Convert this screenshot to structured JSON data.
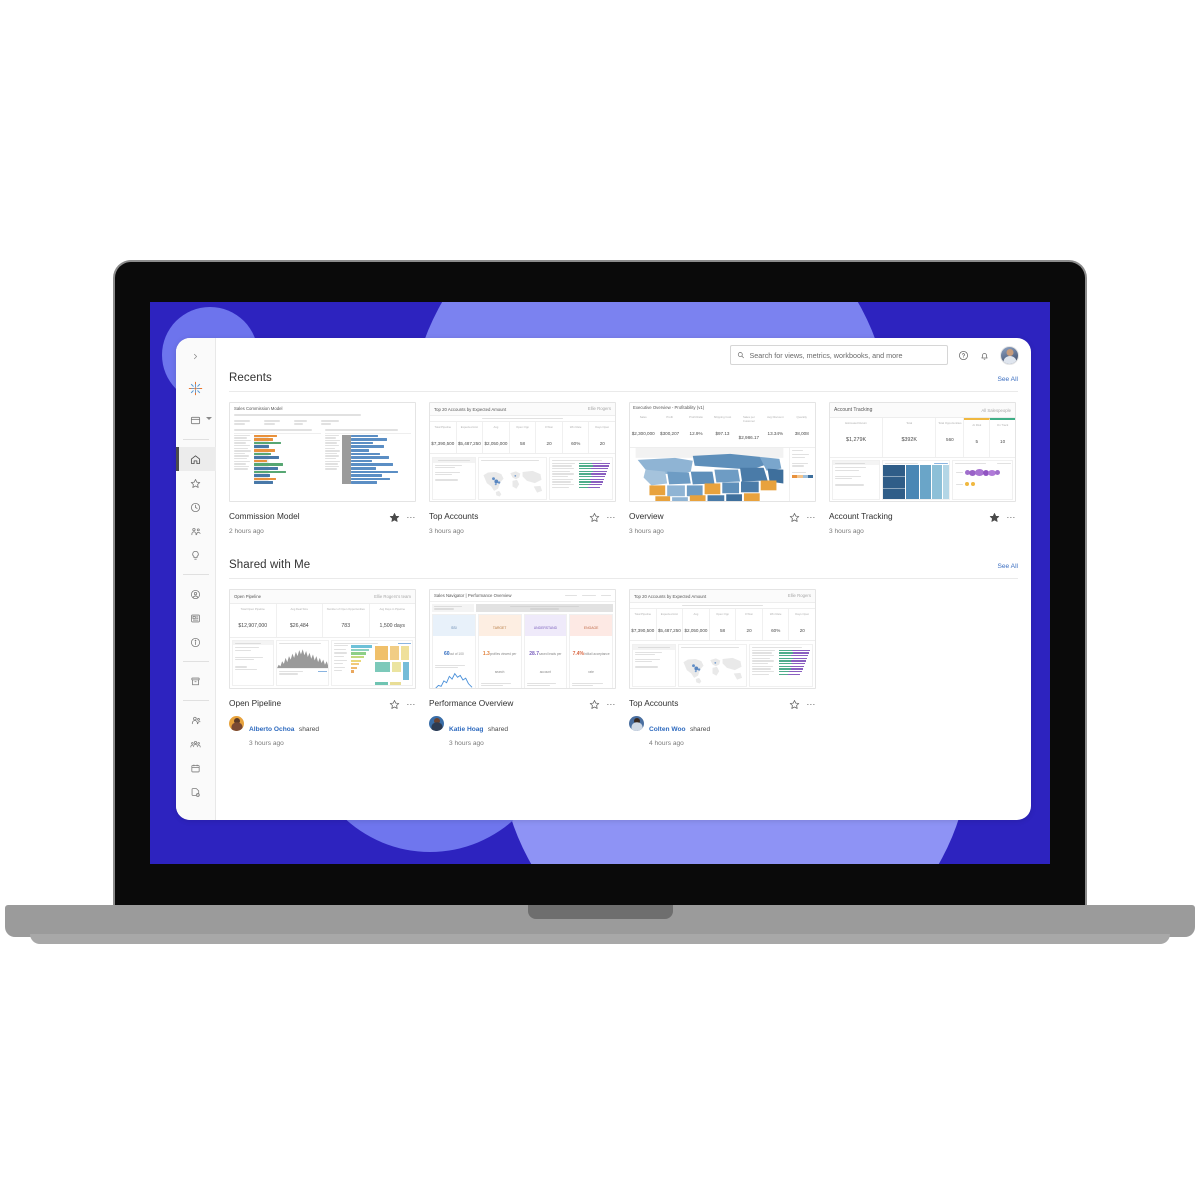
{
  "app": {
    "name": "tableau-home",
    "search": {
      "placeholder": "Search for views, metrics, workbooks, and more",
      "value": ""
    },
    "topbar_icons": [
      "help-icon",
      "notifications-icon",
      "user-avatar"
    ]
  },
  "sidebar": {
    "collapse_label": "›",
    "items": [
      {
        "name": "sidebar-item-explore",
        "icon": "browser-window-icon",
        "active": false,
        "caret": true
      },
      {
        "name": "sidebar-item-home",
        "icon": "home-icon",
        "active": true
      },
      {
        "name": "sidebar-item-favorites",
        "icon": "star-icon",
        "active": false
      },
      {
        "name": "sidebar-item-recents",
        "icon": "clock-history-icon",
        "active": false
      },
      {
        "name": "sidebar-item-shared-with-me",
        "icon": "people-shared-icon",
        "active": false
      },
      {
        "name": "sidebar-item-recommendations",
        "icon": "lightbulb-icon",
        "active": false
      },
      {
        "name": "sidebar-item-personal-space",
        "icon": "person-circle-icon",
        "active": false
      },
      {
        "name": "sidebar-item-collections",
        "icon": "collections-icon",
        "active": false
      },
      {
        "name": "sidebar-item-external-assets",
        "icon": "info-circle-icon",
        "active": false
      },
      {
        "name": "sidebar-item-archive",
        "icon": "archive-box-icon",
        "active": false
      },
      {
        "name": "sidebar-item-users",
        "icon": "users-icon",
        "active": false
      },
      {
        "name": "sidebar-item-groups",
        "icon": "group-icon",
        "active": false
      },
      {
        "name": "sidebar-item-schedules",
        "icon": "calendar-icon",
        "active": false
      },
      {
        "name": "sidebar-item-tasks",
        "icon": "task-page-icon",
        "active": false
      }
    ]
  },
  "sections": [
    {
      "id": "recents",
      "title": "Recents",
      "see_all": "See All",
      "cards": [
        {
          "title": "Commission Model",
          "subtitle": "2 hours ago",
          "favorited": true,
          "menu": "⋯",
          "thumb": {
            "kind": "commission",
            "header": "Sales Commission Model",
            "panel_titles": [
              "Simulated Quota Attainment Results with These Assumptions",
              "Total Compensation with These Assumptions"
            ]
          }
        },
        {
          "title": "Top Accounts",
          "subtitle": "3 hours ago",
          "favorited": false,
          "menu": "⋯",
          "thumb": {
            "kind": "topaccounts",
            "header": "Top 20 Accounts by Expected Amount",
            "owner": "Ellie Rogers",
            "kpis": [
              {
                "label": "Total Pipeline",
                "value": "$7,390,500"
              },
              {
                "label": "Expected Amt",
                "value": "$5,487,250"
              },
              {
                "label": "Avg",
                "value": "$2,050,000"
              },
              {
                "label": "Open Opp",
                "value": "58"
              },
              {
                "label": "# Won",
                "value": "20"
              },
              {
                "label": "Win Rate",
                "value": "60%"
              },
              {
                "label": "Days Open",
                "value": "20"
              }
            ]
          }
        },
        {
          "title": "Overview",
          "subtitle": "3 hours ago",
          "favorited": false,
          "menu": "⋯",
          "thumb": {
            "kind": "overview",
            "header": "Executive Overview - Profitability (v1)",
            "kpi_labels": [
              "Sales",
              "Profit",
              "Profit Ratio",
              "Shipping Cost",
              "Sales per Customer",
              "Avg Discount",
              "Quantity"
            ],
            "kpi_values": [
              "$2,300,000",
              "$300,207",
              "12.9%",
              "$97.13",
              "$2,986.17",
              "13.34%",
              "38,008"
            ]
          }
        },
        {
          "title": "Account Tracking",
          "subtitle": "3 hours ago",
          "favorited": true,
          "menu": "⋯",
          "thumb": {
            "kind": "tracking",
            "header": "Account Tracking",
            "filter": "All Salespeople",
            "kpi_labels": [
              "Estimated Return",
              "Total",
              "Total Opportunities",
              "At Risk",
              "On Track"
            ],
            "kpi_values": [
              "$1,279K",
              "$392K",
              "560",
              "5",
              "10"
            ]
          }
        }
      ]
    },
    {
      "id": "shared-with-me",
      "title": "Shared with Me",
      "see_all": "See All",
      "cards": [
        {
          "title": "Open Pipeline",
          "shared_by": "Alberto Ochoa",
          "shared_verb": "shared",
          "subtitle": "3 hours ago",
          "favorited": false,
          "menu": "⋯",
          "avatar_color": "#e8a33d",
          "thumb": {
            "kind": "pipeline",
            "header": "Open Pipeline",
            "owner": "Ellie Rogers's team",
            "kpi_labels": [
              "Total Open Pipeline",
              "Avg Deal Size",
              "Number of Open Opportunities",
              "Avg Days in Pipeline"
            ],
            "kpi_values": [
              "$12,907,000",
              "$26,484",
              "783",
              "1,500 days"
            ]
          }
        },
        {
          "title": "Performance Overview",
          "shared_by": "Katie Hoag",
          "shared_verb": "shared",
          "subtitle": "3 hours ago",
          "favorited": false,
          "menu": "⋯",
          "avatar_color": "#3a6ea8",
          "thumb": {
            "kind": "performance",
            "header": "Sales Navigator | Performance Overview",
            "cols": [
              {
                "head": "SSI",
                "value": "60",
                "unit": "out of 100",
                "color": "#e8f1fa",
                "accent": "#2f6bbf"
              },
              {
                "head": "TARGET",
                "value": "1.3",
                "unit": "profiles viewed per search",
                "color": "#fdeee2",
                "accent": "#e0803a"
              },
              {
                "head": "UNDERSTAND",
                "value": "28.7",
                "unit": "saved leads per account",
                "color": "#efeafa",
                "accent": "#7a5fbd"
              },
              {
                "head": "ENGAGE",
                "value": "7.4%",
                "unit": "InMail acceptance rate",
                "color": "#fde9e4",
                "accent": "#d9643f"
              }
            ]
          }
        },
        {
          "title": "Top Accounts",
          "shared_by": "Colten Woo",
          "shared_verb": "shared",
          "subtitle": "4 hours ago",
          "favorited": false,
          "menu": "⋯",
          "avatar_color": "#4a6fa0",
          "thumb": {
            "kind": "topaccounts",
            "header": "Top 20 Accounts by Expected Amount",
            "owner": "Ellie Rogers",
            "kpis": [
              {
                "label": "Total Pipeline",
                "value": "$7,390,500"
              },
              {
                "label": "Expected Amt",
                "value": "$5,487,250"
              },
              {
                "label": "Avg",
                "value": "$2,050,000"
              },
              {
                "label": "Open Opp",
                "value": "58"
              },
              {
                "label": "# Won",
                "value": "20"
              },
              {
                "label": "Win Rate",
                "value": "60%"
              },
              {
                "label": "Days Open",
                "value": "20"
              }
            ]
          }
        }
      ]
    }
  ],
  "colors": {
    "screen_bg": "#2d23bf",
    "blob_light": "#8e93f5",
    "blob_mid": "#7b82f0",
    "link": "#3b6ec0",
    "sidebar_bg": "#fafafa"
  }
}
